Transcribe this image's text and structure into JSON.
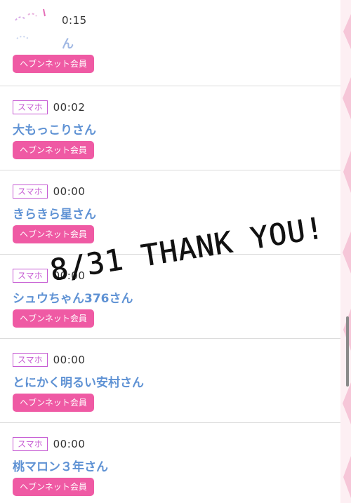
{
  "rows": [
    {
      "device": "",
      "time": "0:15",
      "name": "ん",
      "member_label": "ヘブンネット会員"
    },
    {
      "device": "スマホ",
      "time": "00:02",
      "name": "大もっこりさん",
      "member_label": "ヘブンネット会員"
    },
    {
      "device": "スマホ",
      "time": "00:00",
      "name": "きらきら星さん",
      "member_label": "ヘブンネット会員"
    },
    {
      "device": "スマホ",
      "time": "00:00",
      "name": "シュウちゃん376さん",
      "member_label": "ヘブンネット会員"
    },
    {
      "device": "スマホ",
      "time": "00:00",
      "name": "とにかく明るい安村さん",
      "member_label": "ヘブンネット会員"
    },
    {
      "device": "スマホ",
      "time": "00:00",
      "name": "桃マロン３年さん",
      "member_label": "ヘブンネット会員"
    }
  ],
  "overlay": {
    "text": "8/31 THANK YOU!"
  },
  "colors": {
    "device_badge": "#c65bd3",
    "name": "#5f92d4",
    "member_button": "#ef5aa4",
    "decor_strip": "#fdeff3"
  }
}
